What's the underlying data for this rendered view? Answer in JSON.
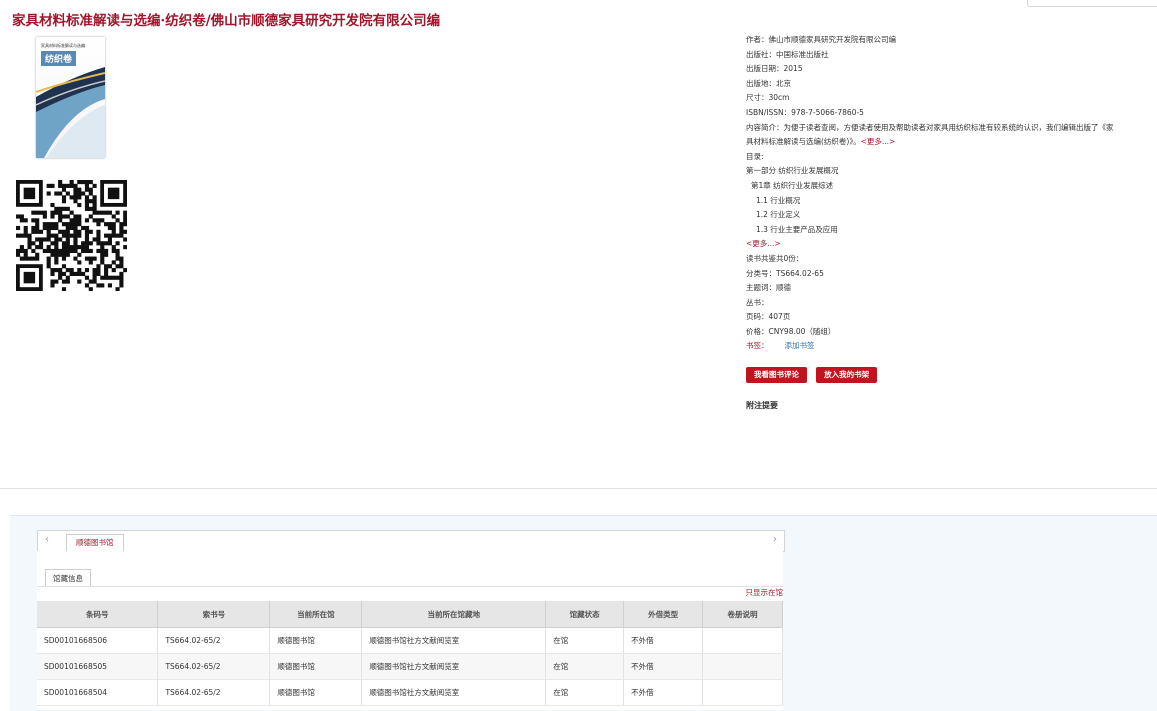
{
  "book": {
    "title": "家具材料标准解读与选编·纺织卷/佛山市顺德家具研究开发院有限公司编",
    "cover": {
      "series": "家具材料标准解读与选编",
      "volume": "纺织卷"
    }
  },
  "info": {
    "author": "作者：佛山市顺德家具研究开发院有限公司编",
    "publisher": "出版社：中国标准出版社",
    "pub_date": "出版日期：2015",
    "pub_place": "出版地：北京",
    "size": "尺寸：30cm",
    "isbn": "ISBN/ISSN：978-7-5066-7860-5",
    "summary": "内容简介：为便于读者查阅，方便读者使用及帮助读者对家具用纺织标准有较系统的认识，我们编辑出版了《家具材料标准解读与选编(纺织卷)》。",
    "summary_more": "<更多...>",
    "toc_label": "目录:",
    "toc_part": "第一部分 纺织行业发展概况",
    "toc_chapter": "第1章 纺织行业发展综述",
    "toc_items": [
      "1.1 行业概况",
      "1.2 行业定义",
      "1.3 行业主要产品及应用"
    ],
    "toc_more": "<更多...>",
    "review_count": "读书共鉴共0份：",
    "class_no": "分类号：TS664.02-65",
    "subject": "主题词：顺德",
    "series": "丛书：",
    "pages": "页码：407页",
    "price": "价格：CNY98.00（随组）",
    "bookmark_label": "书签：",
    "bookmark_link": "添加书签",
    "attach": "附注提要"
  },
  "buttons": {
    "review": "我看图书评论",
    "shelf": "放入我的书架"
  },
  "holdings": {
    "library_tab": "顺德图书馆",
    "subtab": "馆藏信息",
    "only_available": "只显示在馆",
    "columns": [
      "条码号",
      "索书号",
      "当前所在馆",
      "当前所在馆藏地",
      "馆藏状态",
      "外借类型",
      "卷册说明"
    ],
    "rows": [
      [
        "SD00101668506",
        "TS664.02-65/2",
        "顺德图书馆",
        "顺德图书馆社方文献阅览室",
        "在馆",
        "不外借",
        ""
      ],
      [
        "SD00101668505",
        "TS664.02-65/2",
        "顺德图书馆",
        "顺德图书馆社方文献阅览室",
        "在馆",
        "不外借",
        ""
      ],
      [
        "SD00101668504",
        "TS664.02-65/2",
        "顺德图书馆",
        "顺德图书馆社方文献阅览室",
        "在馆",
        "不外借",
        ""
      ]
    ]
  }
}
